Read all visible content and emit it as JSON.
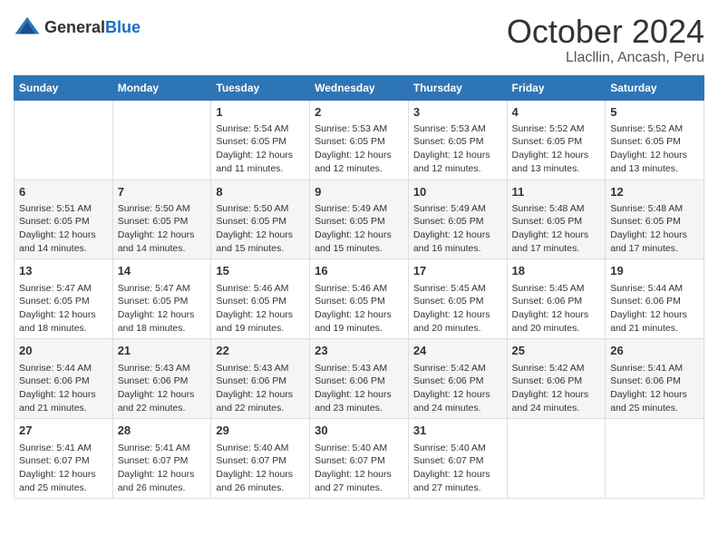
{
  "logo": {
    "general": "General",
    "blue": "Blue"
  },
  "title": "October 2024",
  "subtitle": "Llacllin, Ancash, Peru",
  "headers": [
    "Sunday",
    "Monday",
    "Tuesday",
    "Wednesday",
    "Thursday",
    "Friday",
    "Saturday"
  ],
  "weeks": [
    [
      {
        "day": "",
        "sunrise": "",
        "sunset": "",
        "daylight": ""
      },
      {
        "day": "",
        "sunrise": "",
        "sunset": "",
        "daylight": ""
      },
      {
        "day": "1",
        "sunrise": "Sunrise: 5:54 AM",
        "sunset": "Sunset: 6:05 PM",
        "daylight": "Daylight: 12 hours and 11 minutes."
      },
      {
        "day": "2",
        "sunrise": "Sunrise: 5:53 AM",
        "sunset": "Sunset: 6:05 PM",
        "daylight": "Daylight: 12 hours and 12 minutes."
      },
      {
        "day": "3",
        "sunrise": "Sunrise: 5:53 AM",
        "sunset": "Sunset: 6:05 PM",
        "daylight": "Daylight: 12 hours and 12 minutes."
      },
      {
        "day": "4",
        "sunrise": "Sunrise: 5:52 AM",
        "sunset": "Sunset: 6:05 PM",
        "daylight": "Daylight: 12 hours and 13 minutes."
      },
      {
        "day": "5",
        "sunrise": "Sunrise: 5:52 AM",
        "sunset": "Sunset: 6:05 PM",
        "daylight": "Daylight: 12 hours and 13 minutes."
      }
    ],
    [
      {
        "day": "6",
        "sunrise": "Sunrise: 5:51 AM",
        "sunset": "Sunset: 6:05 PM",
        "daylight": "Daylight: 12 hours and 14 minutes."
      },
      {
        "day": "7",
        "sunrise": "Sunrise: 5:50 AM",
        "sunset": "Sunset: 6:05 PM",
        "daylight": "Daylight: 12 hours and 14 minutes."
      },
      {
        "day": "8",
        "sunrise": "Sunrise: 5:50 AM",
        "sunset": "Sunset: 6:05 PM",
        "daylight": "Daylight: 12 hours and 15 minutes."
      },
      {
        "day": "9",
        "sunrise": "Sunrise: 5:49 AM",
        "sunset": "Sunset: 6:05 PM",
        "daylight": "Daylight: 12 hours and 15 minutes."
      },
      {
        "day": "10",
        "sunrise": "Sunrise: 5:49 AM",
        "sunset": "Sunset: 6:05 PM",
        "daylight": "Daylight: 12 hours and 16 minutes."
      },
      {
        "day": "11",
        "sunrise": "Sunrise: 5:48 AM",
        "sunset": "Sunset: 6:05 PM",
        "daylight": "Daylight: 12 hours and 17 minutes."
      },
      {
        "day": "12",
        "sunrise": "Sunrise: 5:48 AM",
        "sunset": "Sunset: 6:05 PM",
        "daylight": "Daylight: 12 hours and 17 minutes."
      }
    ],
    [
      {
        "day": "13",
        "sunrise": "Sunrise: 5:47 AM",
        "sunset": "Sunset: 6:05 PM",
        "daylight": "Daylight: 12 hours and 18 minutes."
      },
      {
        "day": "14",
        "sunrise": "Sunrise: 5:47 AM",
        "sunset": "Sunset: 6:05 PM",
        "daylight": "Daylight: 12 hours and 18 minutes."
      },
      {
        "day": "15",
        "sunrise": "Sunrise: 5:46 AM",
        "sunset": "Sunset: 6:05 PM",
        "daylight": "Daylight: 12 hours and 19 minutes."
      },
      {
        "day": "16",
        "sunrise": "Sunrise: 5:46 AM",
        "sunset": "Sunset: 6:05 PM",
        "daylight": "Daylight: 12 hours and 19 minutes."
      },
      {
        "day": "17",
        "sunrise": "Sunrise: 5:45 AM",
        "sunset": "Sunset: 6:05 PM",
        "daylight": "Daylight: 12 hours and 20 minutes."
      },
      {
        "day": "18",
        "sunrise": "Sunrise: 5:45 AM",
        "sunset": "Sunset: 6:06 PM",
        "daylight": "Daylight: 12 hours and 20 minutes."
      },
      {
        "day": "19",
        "sunrise": "Sunrise: 5:44 AM",
        "sunset": "Sunset: 6:06 PM",
        "daylight": "Daylight: 12 hours and 21 minutes."
      }
    ],
    [
      {
        "day": "20",
        "sunrise": "Sunrise: 5:44 AM",
        "sunset": "Sunset: 6:06 PM",
        "daylight": "Daylight: 12 hours and 21 minutes."
      },
      {
        "day": "21",
        "sunrise": "Sunrise: 5:43 AM",
        "sunset": "Sunset: 6:06 PM",
        "daylight": "Daylight: 12 hours and 22 minutes."
      },
      {
        "day": "22",
        "sunrise": "Sunrise: 5:43 AM",
        "sunset": "Sunset: 6:06 PM",
        "daylight": "Daylight: 12 hours and 22 minutes."
      },
      {
        "day": "23",
        "sunrise": "Sunrise: 5:43 AM",
        "sunset": "Sunset: 6:06 PM",
        "daylight": "Daylight: 12 hours and 23 minutes."
      },
      {
        "day": "24",
        "sunrise": "Sunrise: 5:42 AM",
        "sunset": "Sunset: 6:06 PM",
        "daylight": "Daylight: 12 hours and 24 minutes."
      },
      {
        "day": "25",
        "sunrise": "Sunrise: 5:42 AM",
        "sunset": "Sunset: 6:06 PM",
        "daylight": "Daylight: 12 hours and 24 minutes."
      },
      {
        "day": "26",
        "sunrise": "Sunrise: 5:41 AM",
        "sunset": "Sunset: 6:06 PM",
        "daylight": "Daylight: 12 hours and 25 minutes."
      }
    ],
    [
      {
        "day": "27",
        "sunrise": "Sunrise: 5:41 AM",
        "sunset": "Sunset: 6:07 PM",
        "daylight": "Daylight: 12 hours and 25 minutes."
      },
      {
        "day": "28",
        "sunrise": "Sunrise: 5:41 AM",
        "sunset": "Sunset: 6:07 PM",
        "daylight": "Daylight: 12 hours and 26 minutes."
      },
      {
        "day": "29",
        "sunrise": "Sunrise: 5:40 AM",
        "sunset": "Sunset: 6:07 PM",
        "daylight": "Daylight: 12 hours and 26 minutes."
      },
      {
        "day": "30",
        "sunrise": "Sunrise: 5:40 AM",
        "sunset": "Sunset: 6:07 PM",
        "daylight": "Daylight: 12 hours and 27 minutes."
      },
      {
        "day": "31",
        "sunrise": "Sunrise: 5:40 AM",
        "sunset": "Sunset: 6:07 PM",
        "daylight": "Daylight: 12 hours and 27 minutes."
      },
      {
        "day": "",
        "sunrise": "",
        "sunset": "",
        "daylight": ""
      },
      {
        "day": "",
        "sunrise": "",
        "sunset": "",
        "daylight": ""
      }
    ]
  ]
}
